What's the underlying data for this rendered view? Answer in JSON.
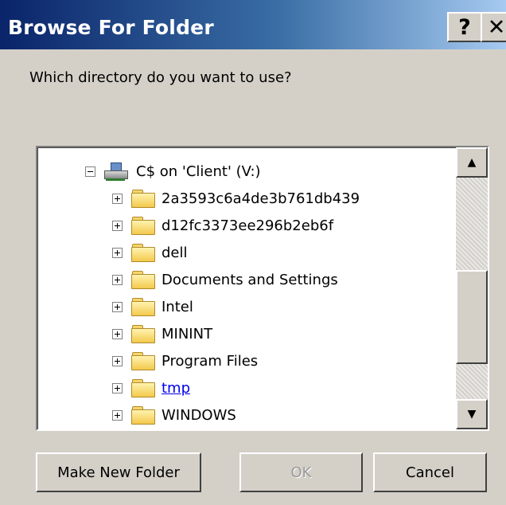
{
  "window": {
    "title": "Browse For Folder",
    "help_label": "?",
    "close_label": "✕"
  },
  "prompt": "Which directory do you want to use?",
  "tree": {
    "root": {
      "label": "C$ on 'Client' (V:)",
      "icon": "network-drive-icon",
      "expanded": true
    },
    "items": [
      {
        "label": "2a3593c6a4de3b761db439"
      },
      {
        "label": "d12fc3373ee296b2eb6f"
      },
      {
        "label": "dell"
      },
      {
        "label": "Documents and Settings"
      },
      {
        "label": "Intel"
      },
      {
        "label": "MININT"
      },
      {
        "label": "Program Files"
      },
      {
        "label": "tmp"
      },
      {
        "label": "WINDOWS"
      }
    ]
  },
  "scrollbar": {
    "up_glyph": "▲",
    "down_glyph": "▼"
  },
  "buttons": {
    "make_new_folder": "Make New Folder",
    "ok": "OK",
    "cancel": "Cancel"
  }
}
